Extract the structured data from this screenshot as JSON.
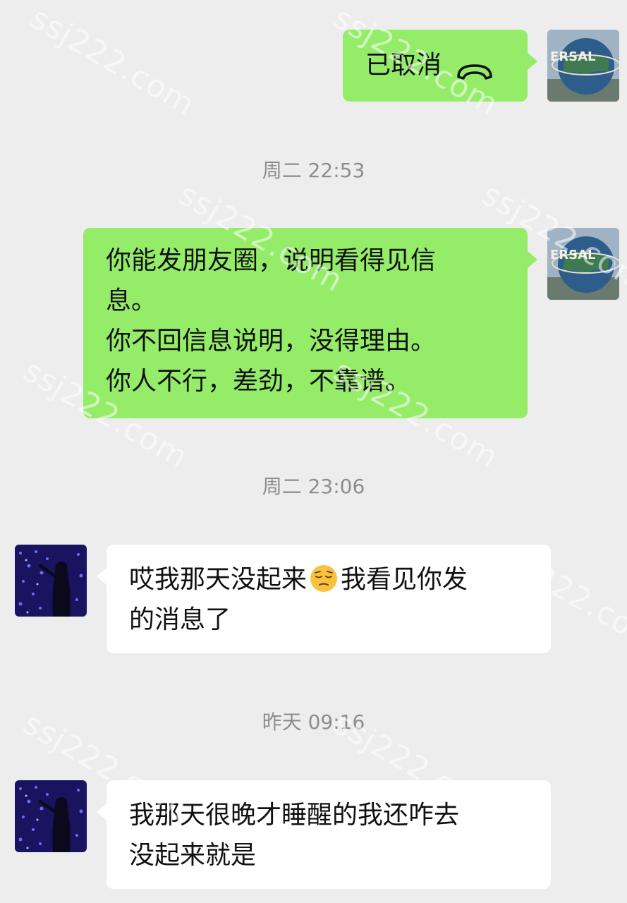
{
  "messages": [
    {
      "id": "m1",
      "side": "out",
      "type": "call",
      "label": "已取消",
      "icon": "phone-hangup-icon"
    },
    {
      "id": "t1",
      "type": "timestamp",
      "text": "周二 22:53"
    },
    {
      "id": "m2",
      "side": "out",
      "type": "text",
      "lines": [
        "你能发朋友圈，说明看得见信",
        "息。",
        "你不回信息说明，没得理由。",
        "你人不行，差劲，不靠谱。"
      ]
    },
    {
      "id": "t2",
      "type": "timestamp",
      "text": "周二 23:06"
    },
    {
      "id": "m3",
      "side": "in",
      "type": "text",
      "line1_before": "哎我那天没起来",
      "emoji": "pensive-face-emoji",
      "line1_after": "我看见你发",
      "line2": "的消息了"
    },
    {
      "id": "t3",
      "type": "timestamp",
      "text": "昨天 09:16"
    },
    {
      "id": "m4",
      "side": "in",
      "type": "text",
      "lines": [
        "我那天很晚才睡醒的我还咋去",
        "没起来就是"
      ]
    }
  ],
  "avatars": {
    "self_avatar_text": "ERSAL",
    "self_avatar_desc": "globe-avatar",
    "peer_avatar_desc": "girl-lights-avatar"
  },
  "watermark": {
    "text": "ssj222.com"
  },
  "colors": {
    "background": "#ededed",
    "outgoing_bubble": "#95ec69",
    "incoming_bubble": "#ffffff",
    "timestamp": "#8d8d8d"
  }
}
